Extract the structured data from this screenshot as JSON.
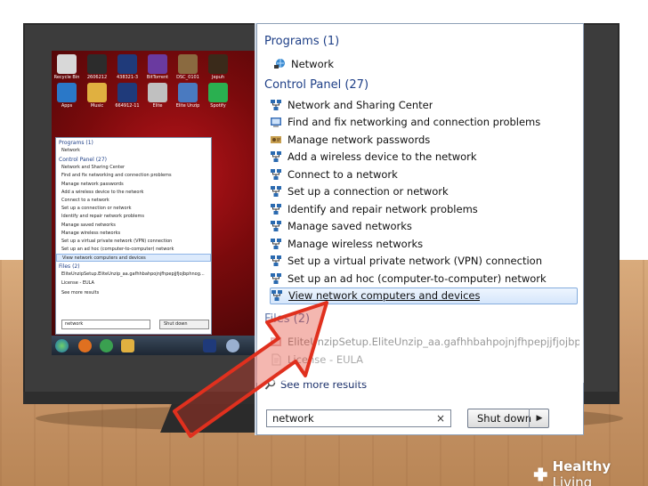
{
  "start_menu": {
    "programs_header": "Programs (1)",
    "programs": [
      {
        "label": "Network",
        "icon": "network-globe-icon"
      }
    ],
    "control_panel_header": "Control Panel (27)",
    "control_panel_items": [
      {
        "label": "Network and Sharing Center",
        "icon": "network-icon"
      },
      {
        "label": "Find and fix networking and connection problems",
        "icon": "troubleshoot-icon"
      },
      {
        "label": "Manage network passwords",
        "icon": "credentials-icon"
      },
      {
        "label": "Add a wireless device to the network",
        "icon": "network-icon"
      },
      {
        "label": "Connect to a network",
        "icon": "network-icon"
      },
      {
        "label": "Set up a connection or network",
        "icon": "network-icon"
      },
      {
        "label": "Identify and repair network problems",
        "icon": "network-icon"
      },
      {
        "label": "Manage saved networks",
        "icon": "network-icon"
      },
      {
        "label": "Manage wireless networks",
        "icon": "network-icon"
      },
      {
        "label": "Set up a virtual private network (VPN) connection",
        "icon": "network-icon"
      },
      {
        "label": "Set up an ad hoc (computer-to-computer) network",
        "icon": "network-icon"
      },
      {
        "label": "View network computers and devices",
        "icon": "network-icon",
        "selected": true
      }
    ],
    "files_header": "Files (2)",
    "files": [
      {
        "label": "EliteUnzipSetup.EliteUnzip_aa.gafhhbahpojnjfhpepjjfjojbphnog...",
        "icon": "installer-icon"
      },
      {
        "label": "License - EULA",
        "icon": "document-icon"
      }
    ],
    "see_more": "See more results",
    "search_value": "network",
    "search_clear": "×",
    "shutdown_label": "Shut down",
    "shutdown_arrow": "▶"
  },
  "mini_menu": {
    "programs_header": "Programs (1)",
    "programs": [
      "Network"
    ],
    "control_panel_header": "Control Panel (27)",
    "control_panel_items": [
      "Network and Sharing Center",
      "Find and fix networking and connection problems",
      "Manage network passwords",
      "Add a wireless device to the network",
      "Connect to a network",
      "Set up a connection or network",
      "Identify and repair network problems",
      "Manage saved networks",
      "Manage wireless networks",
      "Set up a virtual private network (VPN) connection",
      "Set up an ad hoc (computer-to-computer) network",
      "View network computers and devices"
    ],
    "files_header": "Files (2)",
    "files": [
      "EliteUnzipSetup.EliteUnzip_aa.gafhhbahpojnjfhpepjjfjojbphnog...",
      "License - EULA"
    ],
    "see_more": "See more results",
    "search_value": "network",
    "shutdown_label": "Shut down"
  },
  "desktop_icons": [
    {
      "label": "Recycle Bin",
      "color": "#d8d8d8"
    },
    {
      "label": "2606212",
      "color": "#2c2c2c"
    },
    {
      "label": "438321-3",
      "color": "#1f3a7a"
    },
    {
      "label": "BitTorrent",
      "color": "#6a3aa0"
    },
    {
      "label": "DSC_0101",
      "color": "#8a6a40"
    },
    {
      "label": "Jepuh",
      "color": "#3a2a1a"
    },
    {
      "label": "Apps",
      "color": "#2a78c8"
    },
    {
      "label": "Music",
      "color": "#e0b040"
    },
    {
      "label": "664912-11",
      "color": "#1f3a7a"
    },
    {
      "label": "Elite",
      "color": "#c0c0c0"
    },
    {
      "label": "Elite Unzip",
      "color": "#4a7ac0"
    },
    {
      "label": "Spotify",
      "color": "#2ab050"
    }
  ],
  "colors": {
    "accent_header": "#1e3f87",
    "selection_border": "#84acdd",
    "arrow_red": "#e0301e",
    "monitor_bezel": "#3c3c3c"
  },
  "watermark": {
    "prefix": "Healthy",
    "suffix": " Living"
  }
}
